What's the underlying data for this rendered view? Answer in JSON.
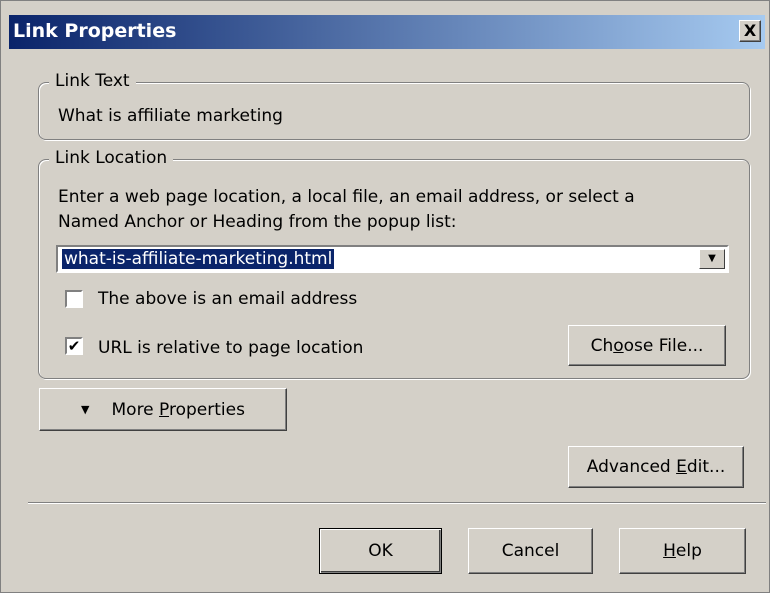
{
  "title": "Link Properties",
  "close_glyph": "X",
  "link_text": {
    "legend": "Link Text",
    "value": "What is affiliate marketing"
  },
  "link_location": {
    "legend": "Link Location",
    "instruction_line1": "Enter a web page location, a local file, an email address, or select a",
    "instruction_line2": "Named Anchor or Heading from the popup list:",
    "combo_value": "what-is-affiliate-marketing.html",
    "email_checkbox": {
      "label": "The above is an email address",
      "checked": false
    },
    "relative_checkbox": {
      "label": "URL is relative to page location",
      "checked": true
    },
    "choose_file": {
      "pre": "Ch",
      "accel": "o",
      "post": "ose File..."
    }
  },
  "more_properties": {
    "pre": "More ",
    "accel": "P",
    "post": "roperties"
  },
  "advanced_edit": {
    "pre": "Advanced ",
    "accel": "E",
    "post": "dit..."
  },
  "ok_label": "OK",
  "cancel_label": "Cancel",
  "help": {
    "pre": "",
    "accel": "H",
    "post": "elp"
  },
  "colors": {
    "face": "#d4d0c8",
    "title_start": "#0a246a",
    "title_end": "#a6caf0",
    "selection": "#0a246a"
  }
}
